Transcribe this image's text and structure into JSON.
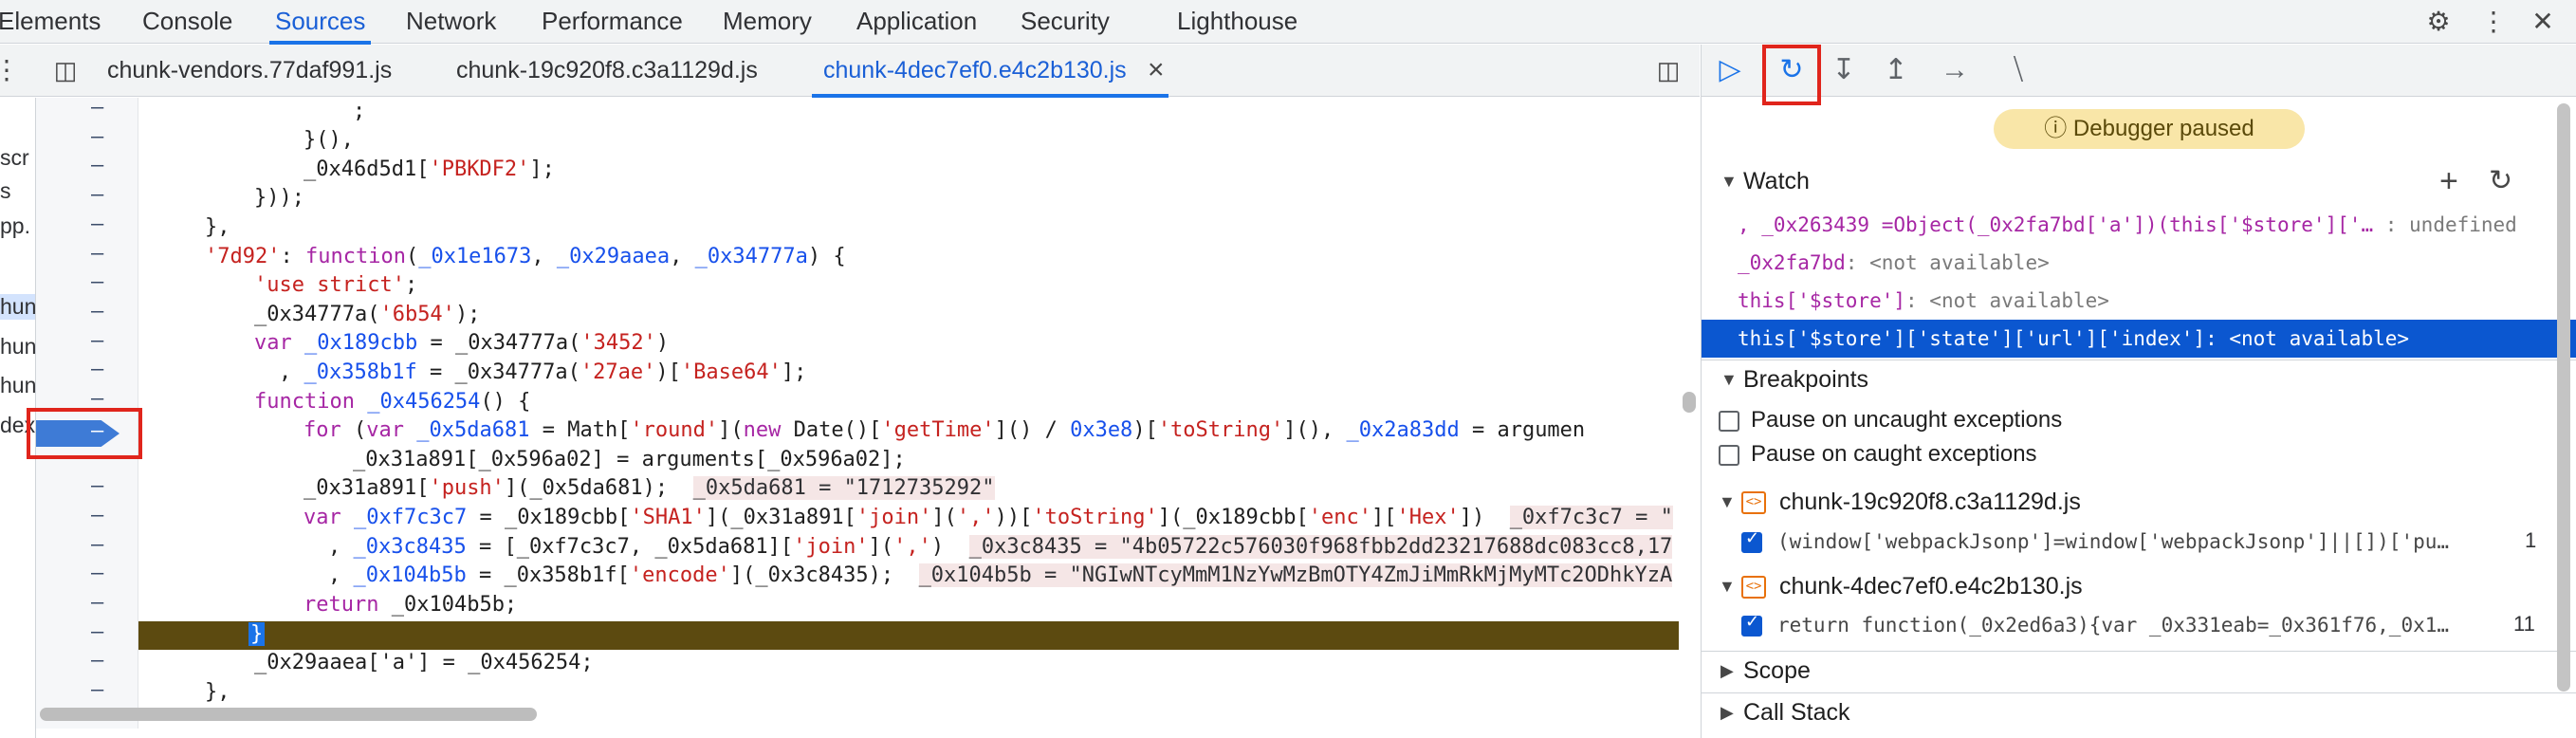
{
  "main_tabs": [
    "Elements",
    "Console",
    "Sources",
    "Network",
    "Performance",
    "Memory",
    "Application",
    "Security",
    "Lighthouse"
  ],
  "active_main_tab": "Sources",
  "file_tabs": [
    "chunk-vendors.77daf991.js",
    "chunk-19c920f8.c3a1129d.js",
    "chunk-4dec7ef0.e4c2b130.js"
  ],
  "active_file_tab": "chunk-4dec7ef0.e4c2b130.js",
  "navigator_fragments": [
    "scr",
    "s",
    "pp.",
    "hun",
    "hun",
    "hun",
    "dex"
  ],
  "gutter_marker": "–",
  "code_lines": [
    ";",
    "}(),",
    "_0x46d5d1['PBKDF2'];",
    "}));",
    "},",
    "'7d92': function(_0x1e1673, _0x29aaea, _0x34777a) {",
    "'use strict';",
    "_0x34777a('6b54');",
    "var _0x189cbb = _0x34777a('3452')",
    ", _0x358b1f = _0x34777a('27ae')['Base64'];",
    "function _0x456254() {",
    "for (var _0x5da681 = Math['round'](new Date()['getTime']() / 0x3e8)['toString'](), _0x2a83dd = argumen",
    "_0x31a891[_0x596a02] = arguments[_0x596a02];",
    "_0x31a891['push'](_0x5da681);",
    "var _0xf7c3c7 = _0x189cbb['SHA1'](_0x31a891['join'](','))['toString'](_0x189cbb['enc']['Hex'])",
    ", _0x3c8435 = [_0xf7c3c7, _0x5da681]['join'](',')",
    ", _0x104b5b = _0x358b1f['encode'](_0x3c8435);",
    "return _0x104b5b;",
    "}",
    "_0x29aaea['a'] = _0x456254;",
    "},"
  ],
  "inline_values": {
    "line14": "_0x5da681 = \"1712735292\"",
    "line15": "_0xf7c3c7 = \"",
    "line16": "_0x3c8435 = \"4b05722c576030f968fbb2dd23217688dc083cc8,17",
    "line17": "_0x104b5b = \"NGIwNTcyMmM1NzYwMzBmOTY4ZmJiMmRkMjMyMTc2ODhkYzA"
  },
  "debugger": {
    "status": "Debugger paused",
    "status_icon": "info-icon",
    "watch_title": "Watch",
    "watch_items": [
      {
        "name": ", _0x263439 =Object(_0x2fa7bd['a'])(this['$store']['…",
        "value": ": undefined"
      },
      {
        "name": "_0x2fa7bd",
        "value": ": <not available>"
      },
      {
        "name": "this['$store']",
        "value": ": <not available>"
      },
      {
        "name": "this['$store']['state']['url']['index']",
        "value": ": <not available>"
      }
    ],
    "breakpoints_title": "Breakpoints",
    "pause_uncaught": "Pause on uncaught exceptions",
    "pause_caught": "Pause on caught exceptions",
    "bp_files": [
      {
        "file": "chunk-19c920f8.c3a1129d.js",
        "code": "(window['webpackJsonp']=window['webpackJsonp']||[])['pu…",
        "line": "1"
      },
      {
        "file": "chunk-4dec7ef0.e4c2b130.js",
        "code": "return function(_0x2ed6a3){var _0x331eab=_0x361f76,_0x1…",
        "line": "11"
      }
    ],
    "scope_title": "Scope",
    "callstack_title": "Call Stack"
  },
  "colors": {
    "accent": "#1a73e8",
    "highlight_box": "#e0251c",
    "paused_line": "#5c4a10",
    "watch_selected": "#0b57d0"
  }
}
